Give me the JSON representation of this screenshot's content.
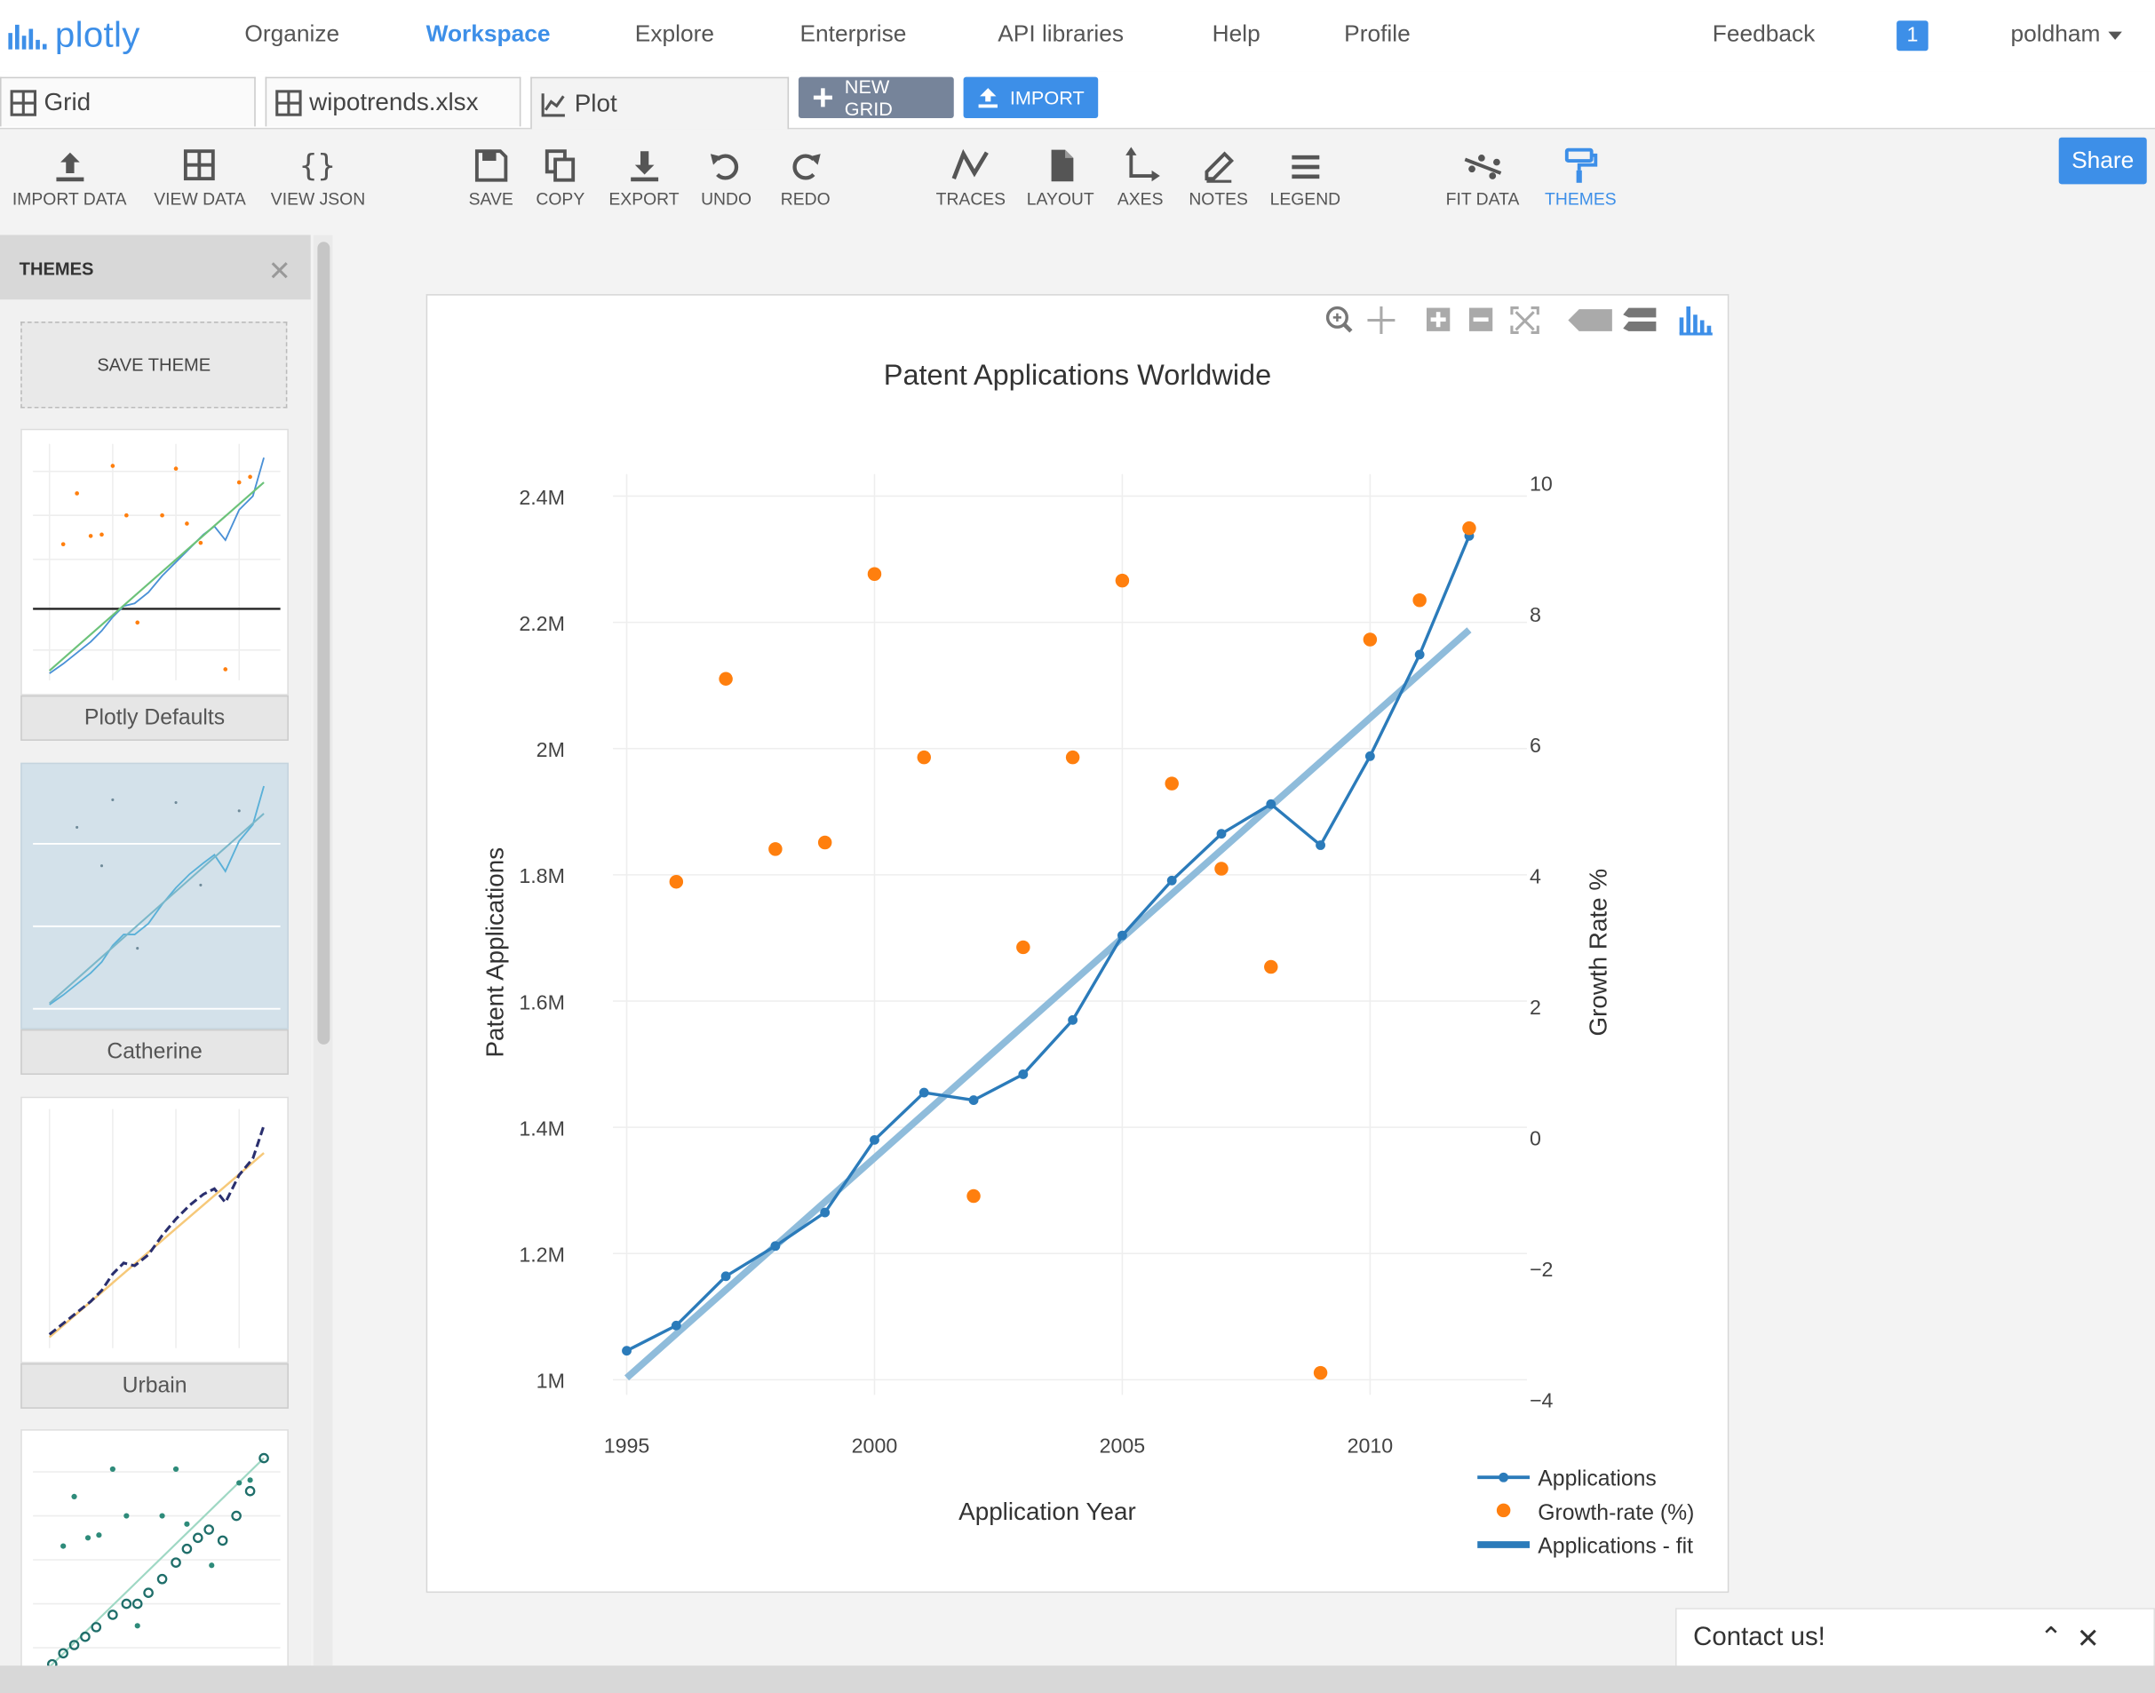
{
  "nav": {
    "logo_text": "plotly",
    "links": [
      "Organize",
      "Workspace",
      "Explore",
      "Enterprise",
      "API libraries",
      "Help",
      "Profile"
    ],
    "active_link": "Workspace",
    "feedback": "Feedback",
    "notification_count": "1",
    "username": "poldham"
  },
  "tabs": {
    "grid": "Grid",
    "file": "wipotrends.xlsx",
    "plot": "Plot",
    "new_grid": "NEW GRID",
    "import": "IMPORT"
  },
  "toolbar": {
    "import_data": "IMPORT DATA",
    "view_data": "VIEW DATA",
    "view_json": "VIEW JSON",
    "save": "SAVE",
    "copy": "COPY",
    "export": "EXPORT",
    "undo": "UNDO",
    "redo": "REDO",
    "traces": "TRACES",
    "layout": "LAYOUT",
    "axes": "AXES",
    "notes": "NOTES",
    "legend": "LEGEND",
    "fit_data": "FIT DATA",
    "themes": "THEMES",
    "share": "Share"
  },
  "themes_panel": {
    "title": "THEMES",
    "save_theme": "SAVE THEME",
    "themes": [
      "Plotly Defaults",
      "Catherine",
      "Urbain"
    ]
  },
  "contact": {
    "label": "Contact us!"
  },
  "colors": {
    "accent": "#3d8fe8",
    "line": "#2b7bba",
    "fit": "#8fbcdb",
    "growth": "#ff7f0e"
  },
  "chart_data": {
    "type": "line",
    "title": "Patent Applications Worldwide",
    "xlabel": "Application Year",
    "ylabel": "Patent Applications",
    "y2label": "Growth Rate %",
    "x_ticks": [
      "1995",
      "2000",
      "2005",
      "2010"
    ],
    "y_ticks": [
      "1M",
      "1.2M",
      "1.4M",
      "1.6M",
      "1.8M",
      "2M",
      "2.2M",
      "2.4M"
    ],
    "y2_ticks": [
      "−4",
      "−2",
      "0",
      "2",
      "4",
      "6",
      "8",
      "10"
    ],
    "xlim": [
      1995,
      2012
    ],
    "ylim": [
      1000000,
      2400000
    ],
    "y2lim": [
      -4,
      10
    ],
    "grid": true,
    "legend_position": "bottom-right",
    "series": [
      {
        "name": "Applications",
        "type": "line+markers",
        "axis": "left",
        "x": [
          1995,
          1996,
          1997,
          1998,
          1999,
          2000,
          2001,
          2002,
          2003,
          2004,
          2005,
          2006,
          2007,
          2008,
          2009,
          2010,
          2011,
          2012
        ],
        "y": [
          1046000,
          1086000,
          1164000,
          1212000,
          1265000,
          1380000,
          1455000,
          1443000,
          1484000,
          1570000,
          1704000,
          1791000,
          1865000,
          1912000,
          1847000,
          1988000,
          2149000,
          2337000
        ]
      },
      {
        "name": "Growth-rate (%)",
        "type": "markers",
        "axis": "right",
        "x": [
          1996,
          1997,
          1998,
          1999,
          2000,
          2001,
          2002,
          2003,
          2004,
          2005,
          2006,
          2007,
          2008,
          2009,
          2010,
          2011,
          2012
        ],
        "y": [
          3.9,
          7.0,
          4.4,
          4.5,
          8.6,
          5.8,
          -0.9,
          2.9,
          5.8,
          8.5,
          5.4,
          4.1,
          2.6,
          -3.6,
          7.6,
          8.2,
          9.3
        ]
      },
      {
        "name": "Applications - fit",
        "type": "line",
        "axis": "left",
        "x": [
          1995,
          2012
        ],
        "y": [
          1003000,
          2188000
        ]
      }
    ]
  }
}
